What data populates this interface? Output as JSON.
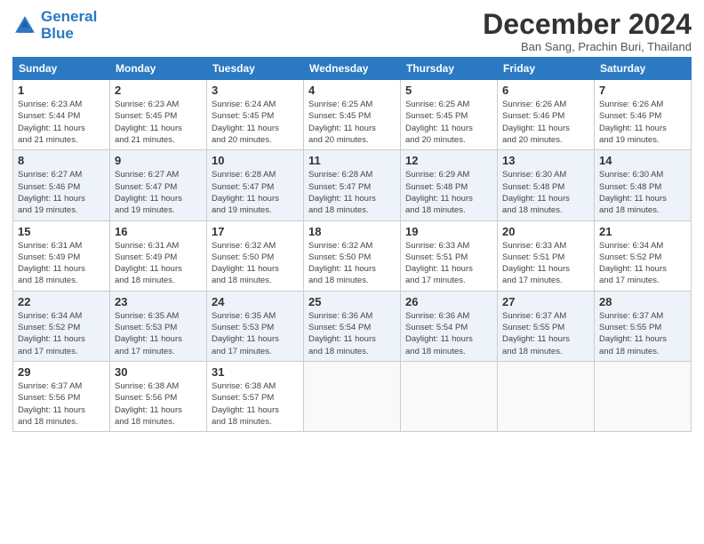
{
  "logo": {
    "line1": "General",
    "line2": "Blue"
  },
  "title": "December 2024",
  "location": "Ban Sang, Prachin Buri, Thailand",
  "days_of_week": [
    "Sunday",
    "Monday",
    "Tuesday",
    "Wednesday",
    "Thursday",
    "Friday",
    "Saturday"
  ],
  "weeks": [
    [
      {
        "day": "1",
        "info": "Sunrise: 6:23 AM\nSunset: 5:44 PM\nDaylight: 11 hours\nand 21 minutes."
      },
      {
        "day": "2",
        "info": "Sunrise: 6:23 AM\nSunset: 5:45 PM\nDaylight: 11 hours\nand 21 minutes."
      },
      {
        "day": "3",
        "info": "Sunrise: 6:24 AM\nSunset: 5:45 PM\nDaylight: 11 hours\nand 20 minutes."
      },
      {
        "day": "4",
        "info": "Sunrise: 6:25 AM\nSunset: 5:45 PM\nDaylight: 11 hours\nand 20 minutes."
      },
      {
        "day": "5",
        "info": "Sunrise: 6:25 AM\nSunset: 5:45 PM\nDaylight: 11 hours\nand 20 minutes."
      },
      {
        "day": "6",
        "info": "Sunrise: 6:26 AM\nSunset: 5:46 PM\nDaylight: 11 hours\nand 20 minutes."
      },
      {
        "day": "7",
        "info": "Sunrise: 6:26 AM\nSunset: 5:46 PM\nDaylight: 11 hours\nand 19 minutes."
      }
    ],
    [
      {
        "day": "8",
        "info": "Sunrise: 6:27 AM\nSunset: 5:46 PM\nDaylight: 11 hours\nand 19 minutes."
      },
      {
        "day": "9",
        "info": "Sunrise: 6:27 AM\nSunset: 5:47 PM\nDaylight: 11 hours\nand 19 minutes."
      },
      {
        "day": "10",
        "info": "Sunrise: 6:28 AM\nSunset: 5:47 PM\nDaylight: 11 hours\nand 19 minutes."
      },
      {
        "day": "11",
        "info": "Sunrise: 6:28 AM\nSunset: 5:47 PM\nDaylight: 11 hours\nand 18 minutes."
      },
      {
        "day": "12",
        "info": "Sunrise: 6:29 AM\nSunset: 5:48 PM\nDaylight: 11 hours\nand 18 minutes."
      },
      {
        "day": "13",
        "info": "Sunrise: 6:30 AM\nSunset: 5:48 PM\nDaylight: 11 hours\nand 18 minutes."
      },
      {
        "day": "14",
        "info": "Sunrise: 6:30 AM\nSunset: 5:48 PM\nDaylight: 11 hours\nand 18 minutes."
      }
    ],
    [
      {
        "day": "15",
        "info": "Sunrise: 6:31 AM\nSunset: 5:49 PM\nDaylight: 11 hours\nand 18 minutes."
      },
      {
        "day": "16",
        "info": "Sunrise: 6:31 AM\nSunset: 5:49 PM\nDaylight: 11 hours\nand 18 minutes."
      },
      {
        "day": "17",
        "info": "Sunrise: 6:32 AM\nSunset: 5:50 PM\nDaylight: 11 hours\nand 18 minutes."
      },
      {
        "day": "18",
        "info": "Sunrise: 6:32 AM\nSunset: 5:50 PM\nDaylight: 11 hours\nand 18 minutes."
      },
      {
        "day": "19",
        "info": "Sunrise: 6:33 AM\nSunset: 5:51 PM\nDaylight: 11 hours\nand 17 minutes."
      },
      {
        "day": "20",
        "info": "Sunrise: 6:33 AM\nSunset: 5:51 PM\nDaylight: 11 hours\nand 17 minutes."
      },
      {
        "day": "21",
        "info": "Sunrise: 6:34 AM\nSunset: 5:52 PM\nDaylight: 11 hours\nand 17 minutes."
      }
    ],
    [
      {
        "day": "22",
        "info": "Sunrise: 6:34 AM\nSunset: 5:52 PM\nDaylight: 11 hours\nand 17 minutes."
      },
      {
        "day": "23",
        "info": "Sunrise: 6:35 AM\nSunset: 5:53 PM\nDaylight: 11 hours\nand 17 minutes."
      },
      {
        "day": "24",
        "info": "Sunrise: 6:35 AM\nSunset: 5:53 PM\nDaylight: 11 hours\nand 17 minutes."
      },
      {
        "day": "25",
        "info": "Sunrise: 6:36 AM\nSunset: 5:54 PM\nDaylight: 11 hours\nand 18 minutes."
      },
      {
        "day": "26",
        "info": "Sunrise: 6:36 AM\nSunset: 5:54 PM\nDaylight: 11 hours\nand 18 minutes."
      },
      {
        "day": "27",
        "info": "Sunrise: 6:37 AM\nSunset: 5:55 PM\nDaylight: 11 hours\nand 18 minutes."
      },
      {
        "day": "28",
        "info": "Sunrise: 6:37 AM\nSunset: 5:55 PM\nDaylight: 11 hours\nand 18 minutes."
      }
    ],
    [
      {
        "day": "29",
        "info": "Sunrise: 6:37 AM\nSunset: 5:56 PM\nDaylight: 11 hours\nand 18 minutes."
      },
      {
        "day": "30",
        "info": "Sunrise: 6:38 AM\nSunset: 5:56 PM\nDaylight: 11 hours\nand 18 minutes."
      },
      {
        "day": "31",
        "info": "Sunrise: 6:38 AM\nSunset: 5:57 PM\nDaylight: 11 hours\nand 18 minutes."
      },
      {
        "day": "",
        "info": ""
      },
      {
        "day": "",
        "info": ""
      },
      {
        "day": "",
        "info": ""
      },
      {
        "day": "",
        "info": ""
      }
    ]
  ]
}
